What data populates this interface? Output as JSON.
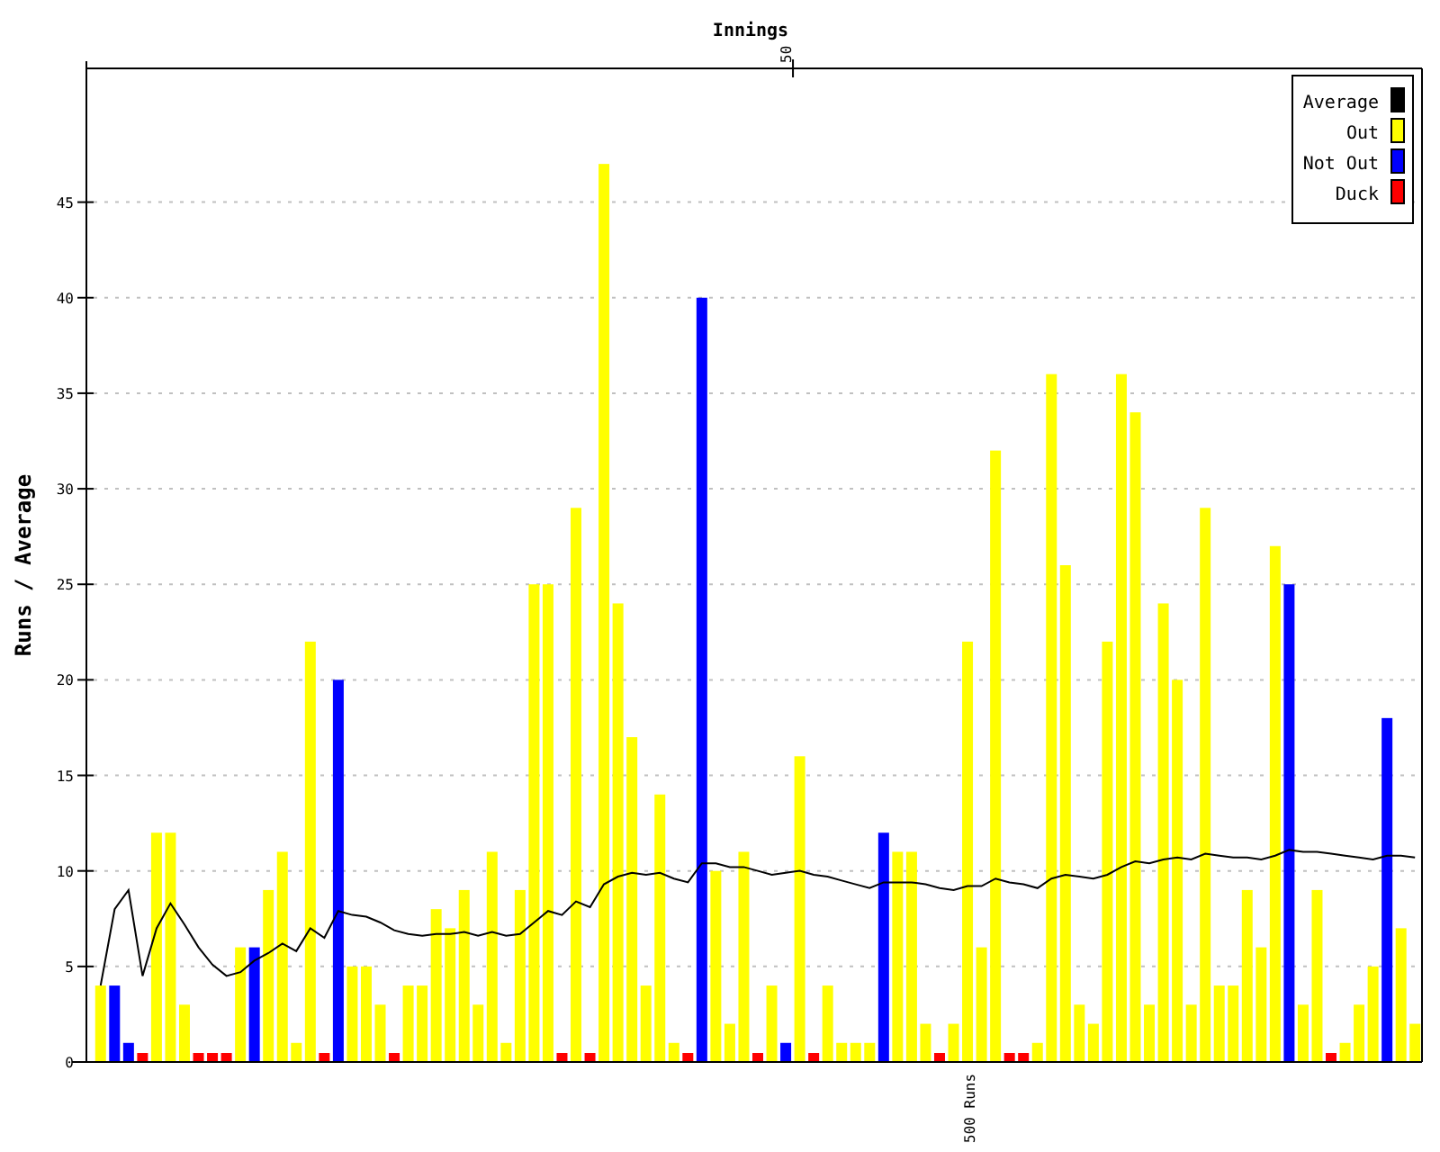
{
  "chart_data": {
    "type": "bar",
    "title": "Innings",
    "ylabel": "Runs / Average",
    "ylim": [
      0,
      52
    ],
    "yticks": [
      0,
      5,
      10,
      15,
      20,
      25,
      30,
      35,
      40,
      45
    ],
    "grid": true,
    "legend": "top-right",
    "annotations": [
      {
        "text": "50"
      },
      {
        "text": "500 Runs"
      }
    ],
    "series": [
      {
        "name": "Average",
        "type": "line",
        "color": "#000000",
        "values": [
          4,
          8,
          9,
          4.5,
          7,
          8.3,
          7.2,
          6,
          5.1,
          4.5,
          4.7,
          5.3,
          5.7,
          6.2,
          5.8,
          7,
          6.5,
          7.9,
          7.7,
          7.6,
          7.3,
          6.9,
          6.7,
          6.6,
          6.7,
          6.7,
          6.8,
          6.6,
          6.8,
          6.6,
          6.7,
          7.3,
          7.9,
          7.7,
          8.4,
          8.1,
          9.3,
          9.7,
          9.9,
          9.8,
          9.9,
          9.6,
          9.4,
          10.4,
          10.4,
          10.2,
          10.2,
          10,
          9.8,
          9.9,
          10,
          9.8,
          9.7,
          9.5,
          9.3,
          9.1,
          9.4,
          9.4,
          9.4,
          9.3,
          9.1,
          9,
          9.2,
          9.2,
          9.6,
          9.4,
          9.3,
          9.1,
          9.6,
          9.8,
          9.7,
          9.6,
          9.8,
          10.2,
          10.5,
          10.4,
          10.6,
          10.7,
          10.6,
          10.9,
          10.8,
          10.7,
          10.7,
          10.6,
          10.8,
          11.1,
          11,
          11,
          10.9,
          10.8,
          10.7,
          10.6,
          10.8,
          10.8,
          10.7
        ]
      },
      {
        "name": "Out",
        "type": "bar",
        "color": "#ffff00",
        "values": [
          4,
          null,
          null,
          null,
          12,
          12,
          3,
          null,
          null,
          null,
          6,
          null,
          9,
          11,
          1,
          22,
          null,
          null,
          5,
          5,
          3,
          null,
          4,
          4,
          8,
          7,
          9,
          3,
          11,
          1,
          9,
          25,
          25,
          null,
          29,
          null,
          47,
          24,
          17,
          4,
          14,
          1,
          null,
          null,
          10,
          2,
          11,
          null,
          4,
          null,
          16,
          null,
          4,
          1,
          1,
          1,
          null,
          11,
          11,
          2,
          null,
          2,
          22,
          6,
          32,
          null,
          null,
          1,
          36,
          26,
          3,
          2,
          22,
          36,
          34,
          3,
          24,
          20,
          3,
          29,
          4,
          4,
          9,
          6,
          27,
          null,
          3,
          9,
          null,
          1,
          3,
          5,
          null,
          7,
          2
        ]
      },
      {
        "name": "Not Out",
        "type": "bar",
        "color": "#0000ff",
        "values": [
          null,
          4,
          1,
          null,
          null,
          null,
          null,
          null,
          null,
          null,
          null,
          6,
          null,
          null,
          null,
          null,
          null,
          20,
          null,
          null,
          null,
          null,
          null,
          null,
          null,
          null,
          null,
          null,
          null,
          null,
          null,
          null,
          null,
          null,
          null,
          null,
          null,
          null,
          null,
          null,
          null,
          null,
          null,
          40,
          null,
          null,
          null,
          null,
          null,
          1,
          null,
          null,
          null,
          null,
          null,
          null,
          12,
          null,
          null,
          null,
          null,
          null,
          null,
          null,
          null,
          null,
          null,
          null,
          null,
          null,
          null,
          null,
          null,
          null,
          null,
          null,
          null,
          null,
          null,
          null,
          null,
          null,
          null,
          null,
          null,
          25,
          null,
          null,
          null,
          null,
          null,
          null,
          18,
          null,
          null
        ]
      },
      {
        "name": "Duck",
        "type": "bar",
        "color": "#ff0000",
        "values": [
          null,
          null,
          null,
          0,
          null,
          null,
          null,
          0,
          0,
          0,
          null,
          null,
          null,
          null,
          null,
          null,
          0,
          null,
          null,
          null,
          null,
          0,
          null,
          null,
          null,
          null,
          null,
          null,
          null,
          null,
          null,
          null,
          null,
          0,
          null,
          0,
          null,
          null,
          null,
          null,
          null,
          null,
          0,
          null,
          null,
          null,
          null,
          0,
          null,
          null,
          null,
          0,
          null,
          null,
          null,
          null,
          null,
          null,
          null,
          null,
          0,
          null,
          null,
          null,
          null,
          0,
          0,
          null,
          null,
          null,
          null,
          null,
          null,
          null,
          null,
          null,
          null,
          null,
          null,
          null,
          null,
          null,
          null,
          null,
          null,
          null,
          null,
          null,
          0,
          null,
          null,
          null,
          null,
          null,
          null
        ]
      }
    ]
  }
}
